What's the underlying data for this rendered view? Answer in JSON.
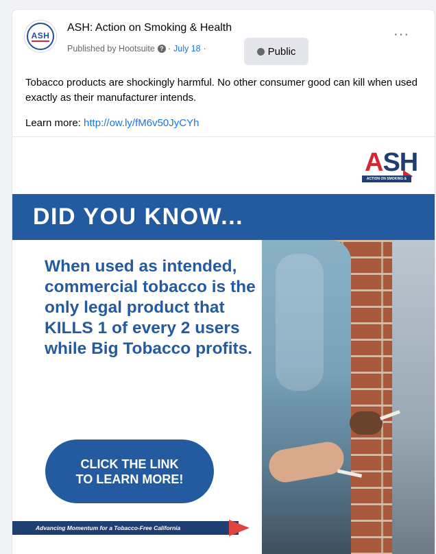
{
  "post": {
    "page_name": "ASH: Action on Smoking & Health",
    "avatar_text": "ASH",
    "published_by": "Published by Hootsuite",
    "info_icon": "?",
    "date_sep": "·",
    "date": "July 18",
    "date_sep2": "·",
    "privacy_label": "Public",
    "more_label": "···",
    "body_text": "Tobacco products are shockingly harmful. No other consumer good can kill when used exactly as their manufacturer intends.",
    "learn_more_prefix": "Learn more:",
    "learn_more_link": "http://ow.ly/fM6v50JyCYh"
  },
  "image": {
    "logo_a": "A",
    "logo_sh": "SH",
    "logo_tagline": "ACTION ON SMOKING & HEALTH",
    "banner_title": "DID YOU KNOW...",
    "headline": "When used as intended, commercial tobacco is the only legal product that KILLS 1 of every 2 users while Big Tobacco profits.",
    "cta_line1": "CLICK THE LINK",
    "cta_line2": "TO LEARN MORE!",
    "footer_text": "Advancing Momentum for a Tobacco-Free California"
  },
  "colors": {
    "brand_blue": "#245a9f",
    "brand_navy": "#1f3f73",
    "brand_red": "#d7262f",
    "link_blue": "#1b74e4"
  },
  "icons": {
    "info": "info-icon",
    "privacy": "globe-icon",
    "more": "more-options-icon"
  }
}
